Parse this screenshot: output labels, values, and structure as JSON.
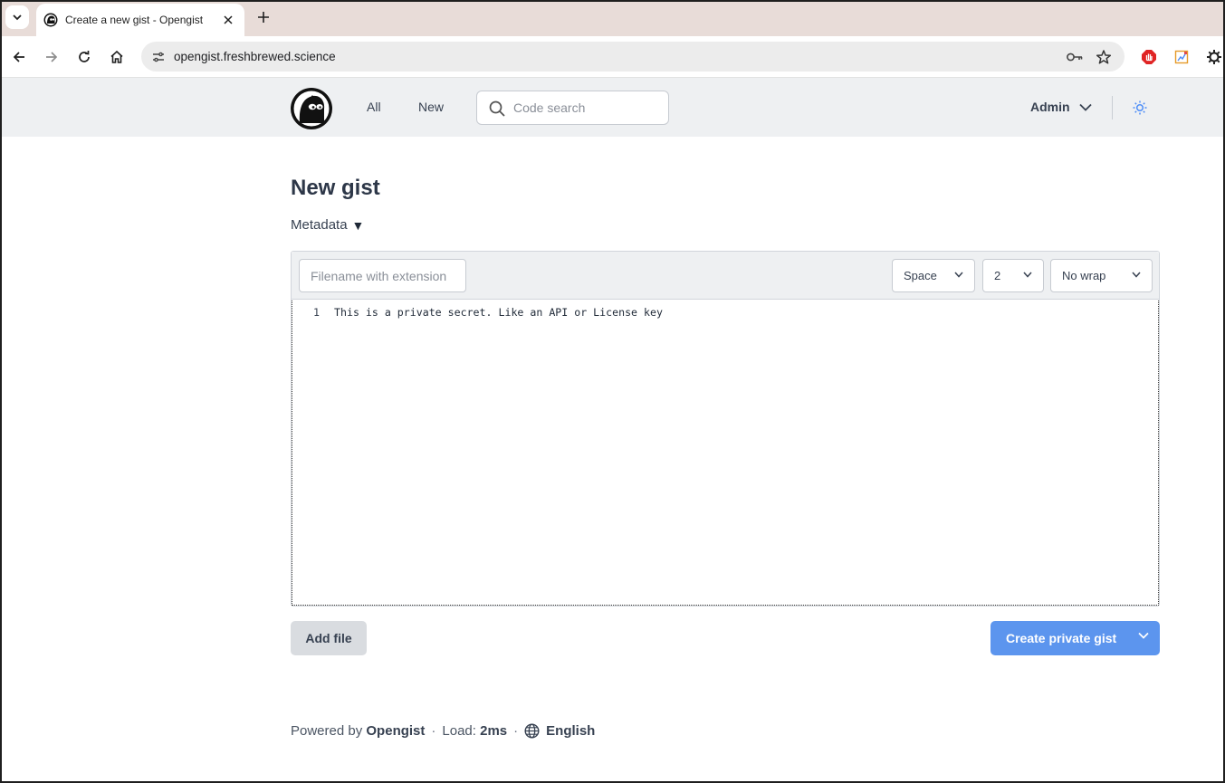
{
  "browser": {
    "tab_title": "Create a new gist - Opengist",
    "url": "opengist.freshbrewed.science"
  },
  "header": {
    "nav": {
      "all": "All",
      "new": "New"
    },
    "search_placeholder": "Code search",
    "user": "Admin"
  },
  "page": {
    "title": "New gist",
    "metadata_label": "Metadata",
    "metadata_toggle": "▼"
  },
  "editor": {
    "filename_placeholder": "Filename with extension",
    "indent_type": "Space",
    "indent_size": "2",
    "wrap_mode": "No wrap",
    "lines": [
      {
        "number": "1",
        "text": "This is a private secret. Like an API or License key"
      }
    ]
  },
  "actions": {
    "add_file": "Add file",
    "create": "Create private gist"
  },
  "footer": {
    "powered_by": "Powered by",
    "brand": "Opengist",
    "sep1": "·",
    "load_label": "Load:",
    "load_value": "2ms",
    "sep2": "·",
    "language": "English"
  },
  "colors": {
    "primary": "#5c95ee",
    "header_bg": "#eef0f2",
    "theme_icon": "#4f8ef7"
  },
  "icons": [
    "tab-search-icon",
    "opengist-favicon-icon",
    "close-icon",
    "plus-icon",
    "back-icon",
    "forward-icon",
    "reload-icon",
    "home-icon",
    "site-info-icon",
    "password-key-icon",
    "bookmark-star-icon",
    "adblock-icon",
    "extension-icon",
    "settings-gear-icon",
    "opengist-logo-icon",
    "search-icon",
    "chevron-down-icon",
    "sun-icon",
    "globe-icon"
  ]
}
